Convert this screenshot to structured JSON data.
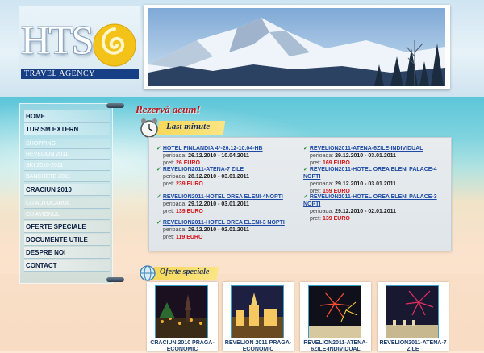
{
  "logo": {
    "letters": "HTS",
    "tagline": "TRAVEL AGENCY"
  },
  "nav": {
    "items": [
      {
        "label": "HOME",
        "type": "main"
      },
      {
        "label": "TURISM EXTERN",
        "type": "main"
      },
      {
        "label": "SHOPPING",
        "type": "sub"
      },
      {
        "label": "REVELION 2011",
        "type": "sub"
      },
      {
        "label": "SKI 2010-2011",
        "type": "sub"
      },
      {
        "label": "BANCHETE 2011",
        "type": "sub"
      },
      {
        "label": "CRACIUN 2010",
        "type": "main"
      },
      {
        "label": "CU AUTOCARUL",
        "type": "sub"
      },
      {
        "label": "CU AVIONUL",
        "type": "sub"
      },
      {
        "label": "OFERTE SPECIALE",
        "type": "main"
      },
      {
        "label": "DOCUMENTE UTILE",
        "type": "main"
      },
      {
        "label": "DESPRE NOI",
        "type": "main"
      },
      {
        "label": "CONTACT",
        "type": "main"
      }
    ]
  },
  "rezerva": "Rezervă acum!",
  "last_minute": {
    "title": "Last minute",
    "offers_left": [
      {
        "title": "HOTEL FINLANDIA 4*-26.12-10.04-HB",
        "period_label": "perioada:",
        "period": "26.12.2010 - 10.04.2011",
        "price_label": "pret:",
        "price": "26 EURO"
      },
      {
        "title": "REVELION2011-ATENA-7 ZILE",
        "period_label": "perioada:",
        "period": "28.12.2010 - 03.01.2011",
        "price_label": "pret:",
        "price": "239 EURO"
      },
      {
        "title": "REVELION2011-HOTEL OREA ELENI-4NOPTI",
        "period_label": "perioada:",
        "period": "29.12.2010 - 03.01.2011",
        "price_label": "pret:",
        "price": "139 EURO"
      },
      {
        "title": "REVELION2011-HOTEL OREA ELENI-3 NOPTI",
        "period_label": "perioada:",
        "period": "29.12.2010 - 02.01.2011",
        "price_label": "pret:",
        "price": "119 EURO"
      }
    ],
    "offers_right": [
      {
        "title": "REVELION2011-ATENA-6ZILE-INDIVIDUAL",
        "period_label": "perioada:",
        "period": "29.12.2010 - 03.01.2011",
        "price_label": "pret:",
        "price": "169 EURO"
      },
      {
        "title": "REVELION2011-HOTEL OREA ELENI PALACE-4 NOPTI",
        "period_label": "perioada:",
        "period": "29.12.2010 - 03.01.2011",
        "price_label": "pret:",
        "price": "159 EURO"
      },
      {
        "title": "REVELION2011-HOTEL OREA ELENI PALACE-3 NOPTI",
        "period_label": "perioada:",
        "period": "29.12.2010 - 02.01.2011",
        "price_label": "pret:",
        "price": "139 EURO"
      }
    ]
  },
  "oferte_speciale": {
    "title": "Oferte speciale",
    "cards": [
      {
        "caption": "CRACIUN 2010 PRAGA-ECONOMIC"
      },
      {
        "caption": "REVELION 2011 PRAGA-ECONOMIC"
      },
      {
        "caption": "REVELION2011-ATENA-6ZILE-INDIVIDUAL"
      },
      {
        "caption": "REVELION2011-ATENA-7 ZILE"
      }
    ]
  },
  "colors": {
    "accent": "#1d4aa6",
    "price": "#d4141a",
    "rezerva": "#c0171a",
    "banner": "#f7d85a",
    "logo_bar": "#163f86"
  }
}
